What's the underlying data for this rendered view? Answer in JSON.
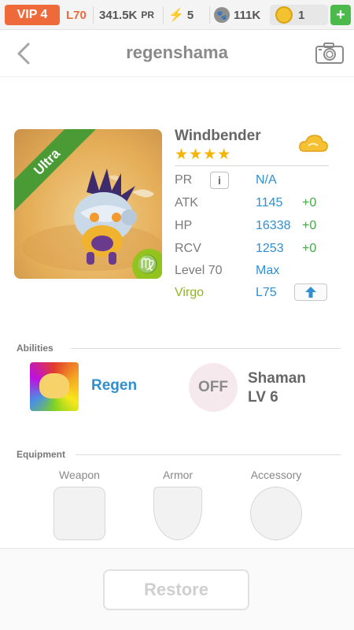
{
  "status_bar": {
    "vip": "VIP 4",
    "level": "L70",
    "pr_value": "341.5K",
    "pr_unit": "PR",
    "energy": "5",
    "paw_count": "111K",
    "coins": "1",
    "plus_label": "+"
  },
  "nav": {
    "title": "regenshama"
  },
  "pet": {
    "name": "Windbender",
    "stars": "★★★★",
    "rarity_badge": "Ultra",
    "zodiac_glyph": "♍",
    "stats": [
      {
        "label": "PR",
        "value": "N/A",
        "bonus": ""
      },
      {
        "label": "ATK",
        "value": "1145",
        "bonus": "+0"
      },
      {
        "label": "HP",
        "value": "16338",
        "bonus": "+0"
      },
      {
        "label": "RCV",
        "value": "1253",
        "bonus": "+0"
      },
      {
        "label": "Level 70",
        "value": "Max",
        "bonus": ""
      },
      {
        "label": "Virgo",
        "value": "L75",
        "bonus": ""
      }
    ],
    "info_icon_text": "i"
  },
  "abilities": {
    "section_label": "Abilities",
    "ability_name": "Regen",
    "off_label": "OFF",
    "passive_name": "Shaman",
    "passive_level": "LV 6"
  },
  "equipment": {
    "section_label": "Equipment",
    "slots": [
      "Weapon",
      "Armor",
      "Accessory"
    ]
  },
  "footer": {
    "restore_label": "Restore"
  },
  "colors": {
    "accent_orange": "#ef6a3a",
    "value_blue": "#2f8fd1",
    "bonus_green": "#44a748",
    "zodiac_green": "#8db624",
    "star_gold": "#f5b400"
  }
}
